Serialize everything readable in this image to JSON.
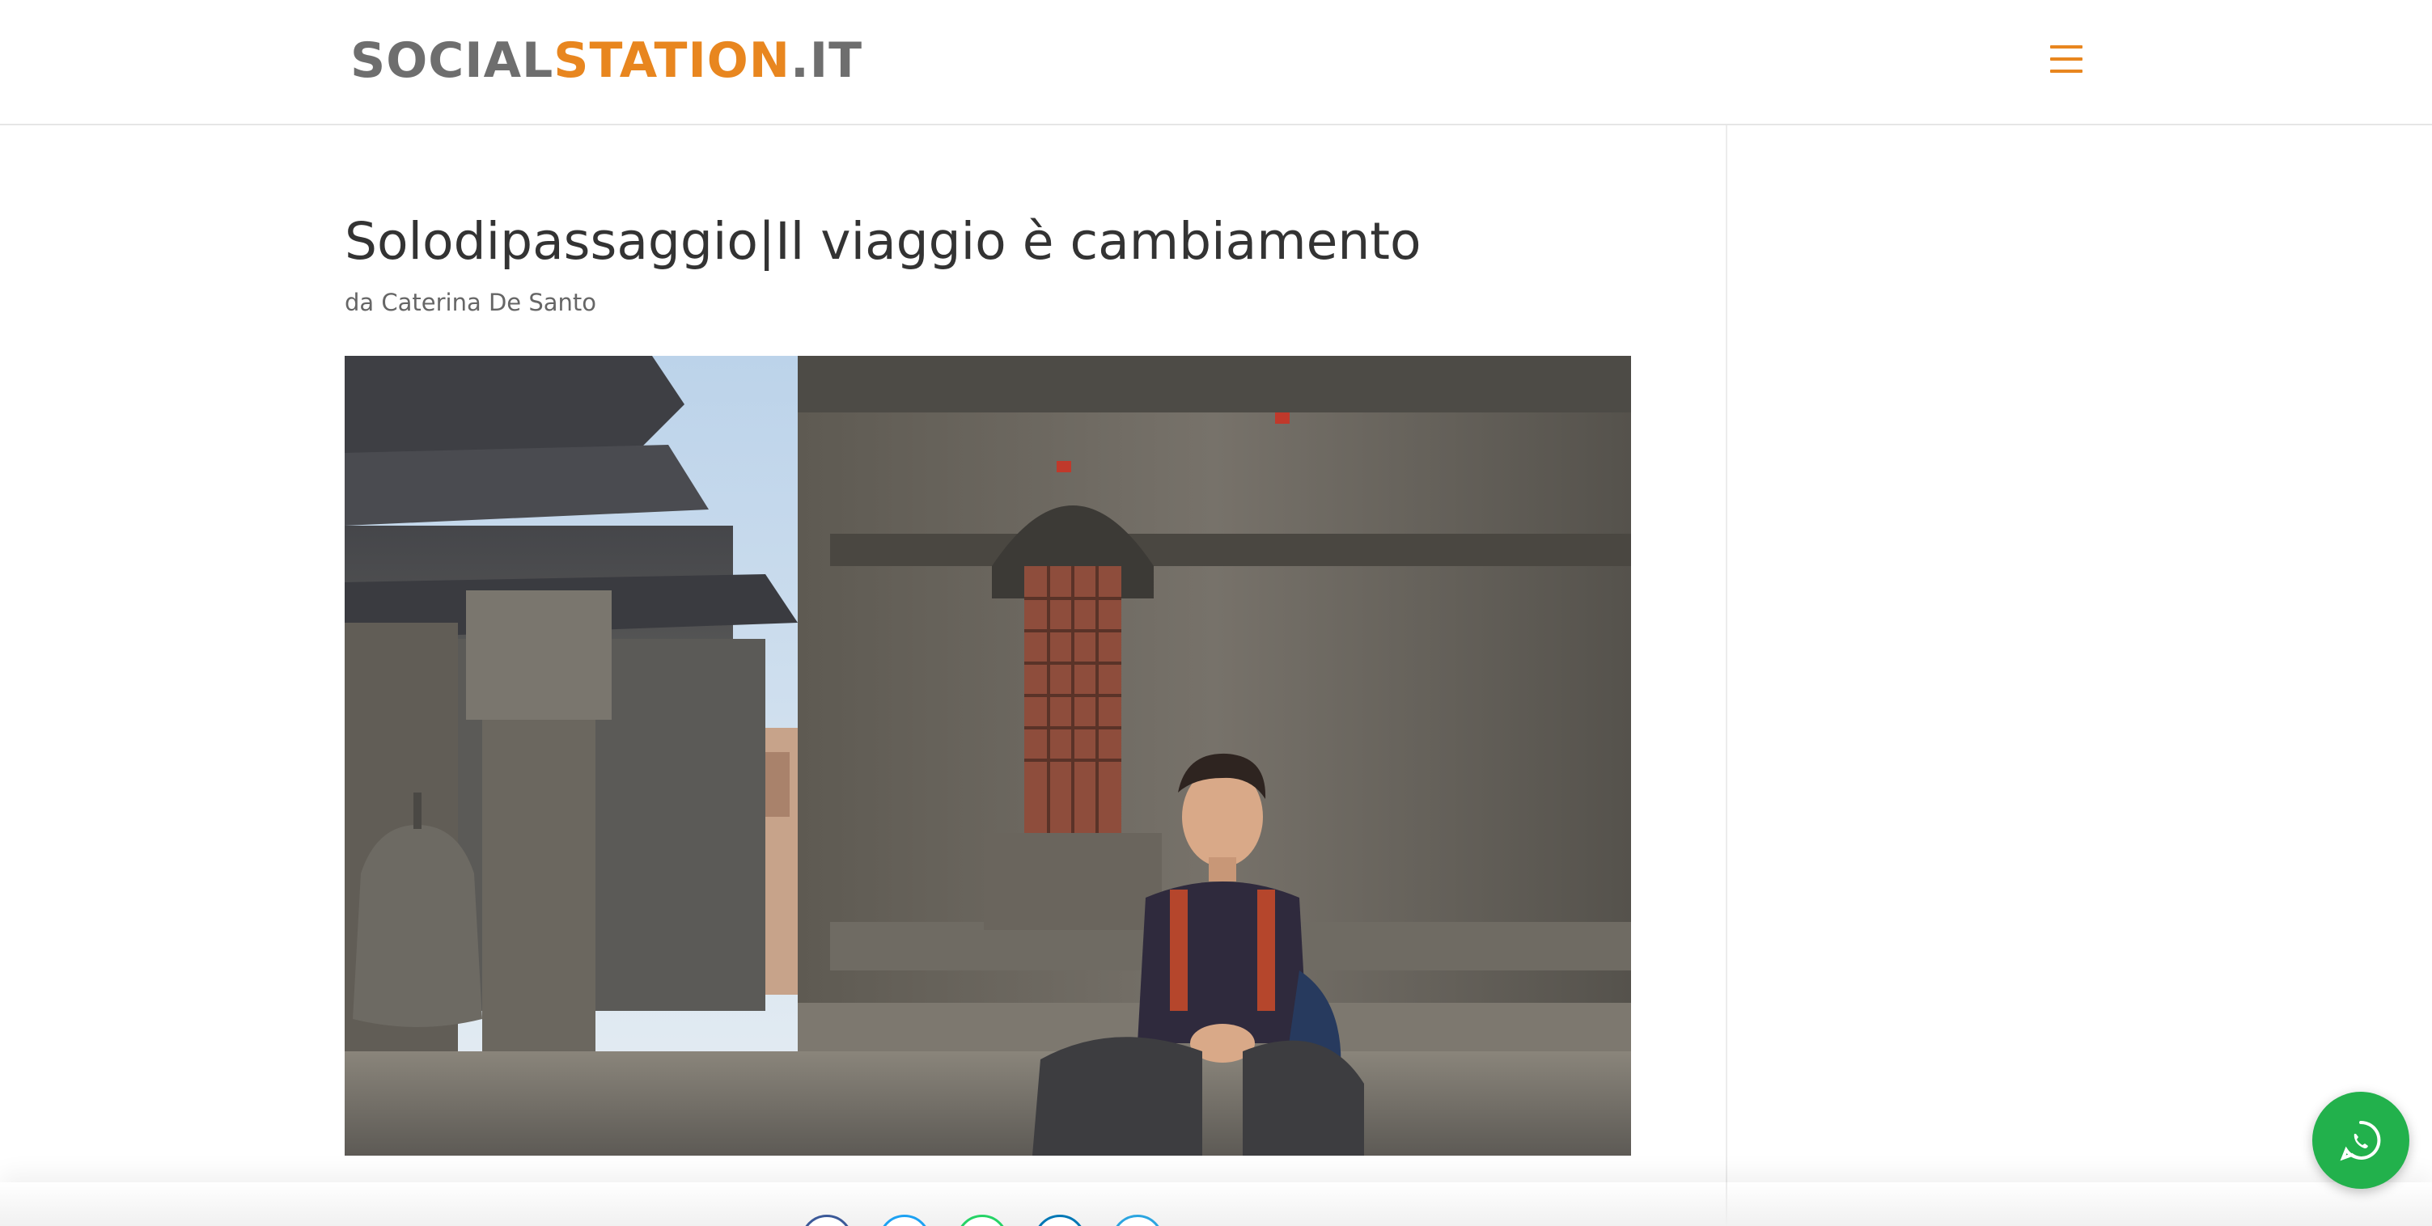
{
  "header": {
    "logo_part1": "SOCIAL",
    "logo_part2": "STATION",
    "logo_part3": ".IT",
    "menu_icon": "hamburger-icon"
  },
  "article": {
    "title": "Solodipassaggio|Il viaggio è cambiamento",
    "byline": "da Caterina De Santo",
    "image_alt": "Ragazzo sorridente accovacciato davanti a un tempio in pietra"
  },
  "share": {
    "icons": [
      "facebook-icon",
      "twitter-icon",
      "whatsapp-icon",
      "linkedin-icon",
      "telegram-icon"
    ]
  },
  "floating": {
    "whatsapp_icon": "whatsapp-icon"
  },
  "colors": {
    "accent": "#e8861f",
    "logo_gray": "#6e6e6e",
    "whatsapp": "#22b14c"
  }
}
